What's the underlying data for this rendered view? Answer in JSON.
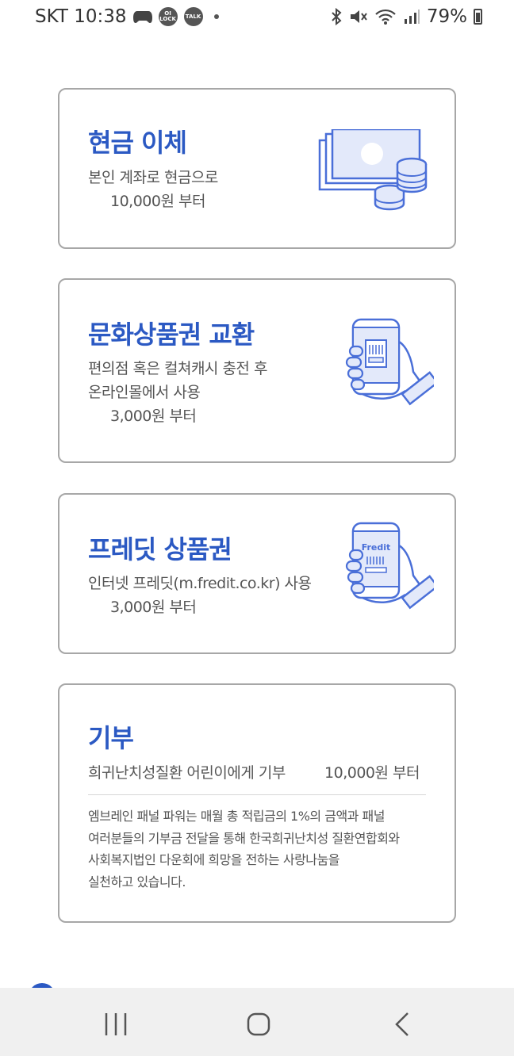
{
  "status": {
    "carrier_time": "SKT 10:38",
    "badge1": "OI LOCK",
    "badge2": "TALK",
    "battery": "79%"
  },
  "cards": [
    {
      "title": "현금 이체",
      "lines": [
        "본인 계좌로 현금으로"
      ],
      "amount": "10,000원 부터",
      "icon": "cash-icon"
    },
    {
      "title": "문화상품권 교환",
      "lines": [
        "편의점 혹은 컬쳐캐시 충전 후",
        "온라인몰에서 사용"
      ],
      "amount": "3,000원 부터",
      "icon": "phone-hand-icon"
    },
    {
      "title": "프레딧 상품권",
      "lines": [
        "인터넷 프레딧(m.fredit.co.kr) 사용"
      ],
      "amount": "3,000원 부터",
      "icon": "phone-hand-icon",
      "phone_label": "Fredit"
    }
  ],
  "donation": {
    "title": "기부",
    "desc": "희귀난치성질환 어린이에게 기부",
    "amount": "10,000원 부터",
    "note": [
      "엠브레인 패널 파워는 매월 총 적립금의 1%의 금액과 패널",
      "여러분들의 기부금 전달을 통해 한국희귀난치성 질환연합회와",
      "사회복지법인 다운회에 희망을 전하는 사랑나눔을",
      "실천하고 있습니다."
    ]
  },
  "colors": {
    "accent": "#2b59c3",
    "border": "#a7a7a7",
    "illustration": "#4a6fd8",
    "illustration_fill": "#e3e9fa"
  },
  "nav": {
    "recent": "recent-apps-icon",
    "home": "home-icon",
    "back": "back-icon"
  }
}
